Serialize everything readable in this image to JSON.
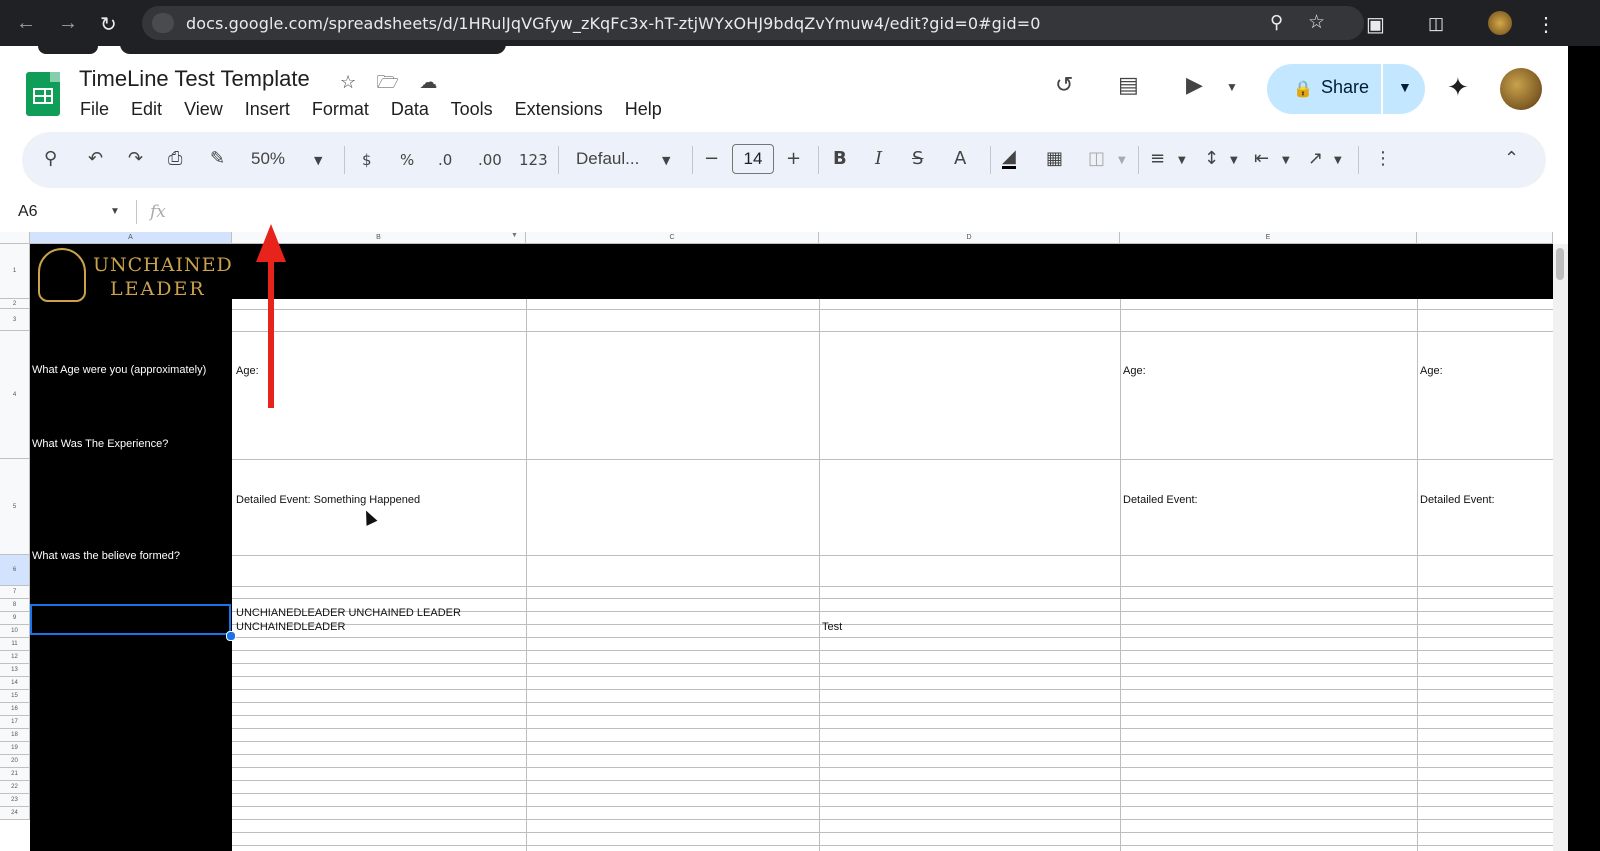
{
  "browser": {
    "url": "docs.google.com/spreadsheets/d/1HRulJqVGfyw_zKqFc3x-hT-ztjWYxOHJ9bdqZvYmuw4/edit?gid=0#gid=0"
  },
  "doc": {
    "title": "TimeLine Test Template"
  },
  "menu": [
    "File",
    "Edit",
    "View",
    "Insert",
    "Format",
    "Data",
    "Tools",
    "Extensions",
    "Help"
  ],
  "share": {
    "label": "Share"
  },
  "toolbar": {
    "zoom": "50%",
    "currency": "$",
    "percent": "%",
    "decrease_decimal": ".0",
    "increase_decimal": ".00",
    "number_format": "123",
    "font": "Defaul...",
    "font_size": "14",
    "bold": "B",
    "italic": "I",
    "text_color": "A"
  },
  "formula_bar": {
    "name_box": "A6",
    "fx": "fx"
  },
  "columns": [
    "A",
    "B",
    "C",
    "D",
    "E"
  ],
  "rows": [
    "1",
    "2",
    "3",
    "4",
    "5",
    "6",
    "7",
    "8",
    "9",
    "10",
    "11",
    "12",
    "13",
    "14",
    "15",
    "16",
    "17",
    "18",
    "19",
    "20",
    "21",
    "22",
    "23",
    "24"
  ],
  "brand": {
    "line1": "UNCHAINED",
    "line2": "LEADER"
  },
  "sheet": {
    "row3_label": "What Age were you (approximately)",
    "row4_label": "What Was The Experience?",
    "row5_label": "What was the believe formed?",
    "b3": "Age:",
    "e3": "Age:",
    "f3": "Age:",
    "b4": "Detailed Event: Something Happened",
    "e4": "Detailed Event:",
    "f4": "Detailed Event:",
    "b6_line1": "UNCHIANEDLEADER   UNCHAINED LEADER",
    "b6_line2": "UNCHAINEDLEADER",
    "d6": "Test"
  },
  "colors": {
    "share_bg": "#c2e7ff",
    "selection": "#1a73e8",
    "annotation_arrow": "#e8231b",
    "brand_gold": "#c9a24b"
  }
}
